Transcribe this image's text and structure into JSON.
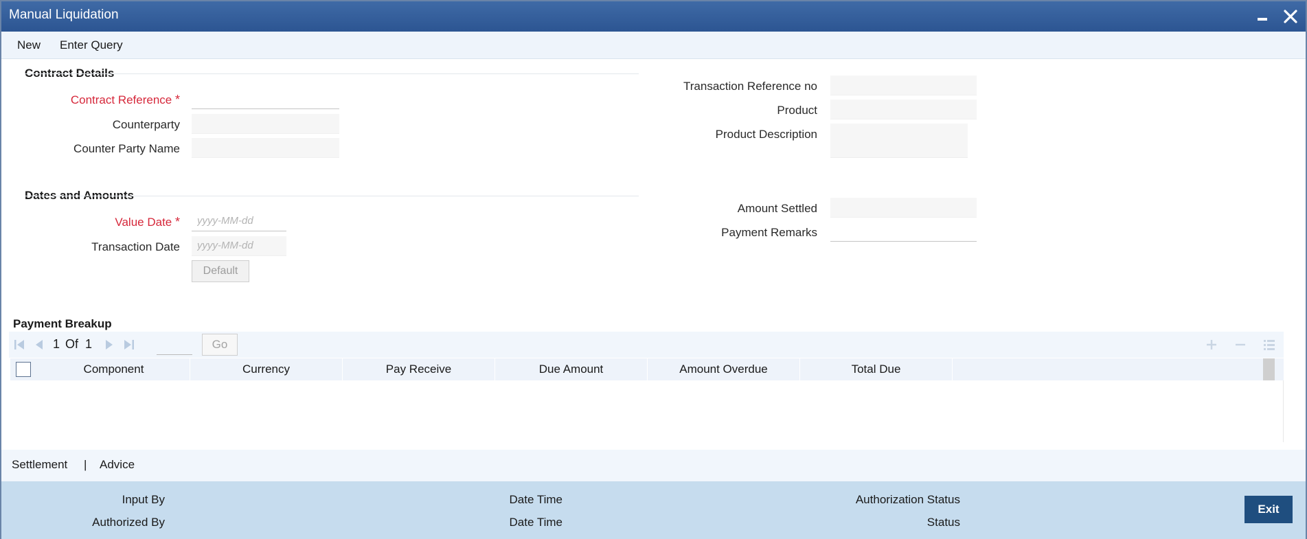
{
  "window": {
    "title": "Manual Liquidation"
  },
  "menu": {
    "new_label": "New",
    "enter_query_label": "Enter Query"
  },
  "contract_details": {
    "heading": "Contract Details",
    "contract_reference_label": "Contract Reference",
    "contract_reference_value": "",
    "counterparty_label": "Counterparty",
    "counterparty_value": "",
    "counterparty_name_label": "Counter Party Name",
    "counterparty_name_value": "",
    "transaction_reference_label": "Transaction Reference no",
    "transaction_reference_value": "",
    "product_label": "Product",
    "product_value": "",
    "product_description_label": "Product Description",
    "product_description_value": ""
  },
  "dates_amounts": {
    "heading": "Dates and Amounts",
    "value_date_label": "Value Date",
    "value_date_placeholder": "yyyy-MM-dd",
    "transaction_date_label": "Transaction Date",
    "transaction_date_placeholder": "yyyy-MM-dd",
    "default_button": "Default",
    "amount_settled_label": "Amount Settled",
    "amount_settled_value": "",
    "payment_remarks_label": "Payment Remarks",
    "payment_remarks_value": ""
  },
  "required_marker": "*",
  "payment_breakup": {
    "heading": "Payment Breakup",
    "pagination": {
      "current": "1",
      "of_label": "Of",
      "total": "1",
      "go_label": "Go"
    },
    "columns": [
      "Component",
      "Currency",
      "Pay Receive",
      "Due Amount",
      "Amount Overdue",
      "Total Due"
    ],
    "rows": []
  },
  "tabs": {
    "settlement": "Settlement",
    "separator": "|",
    "advice": "Advice"
  },
  "footer": {
    "input_by_label": "Input By",
    "authorized_by_label": "Authorized By",
    "date_time_label_1": "Date Time",
    "date_time_label_2": "Date Time",
    "authorization_status_label": "Authorization Status",
    "status_label": "Status",
    "exit_label": "Exit"
  },
  "colors": {
    "titlebar": "#2c5592",
    "required": "#d6283b",
    "footer_bg": "#c6dcee",
    "exit_button": "#1f4e7f"
  },
  "icons": {
    "minimize": "minimize-icon",
    "close": "close-icon",
    "first_page": "first-page-icon",
    "prev_page": "prev-page-icon",
    "next_page": "next-page-icon",
    "last_page": "last-page-icon",
    "add_row": "plus-icon",
    "delete_row": "minus-icon",
    "single_view": "list-view-icon"
  }
}
